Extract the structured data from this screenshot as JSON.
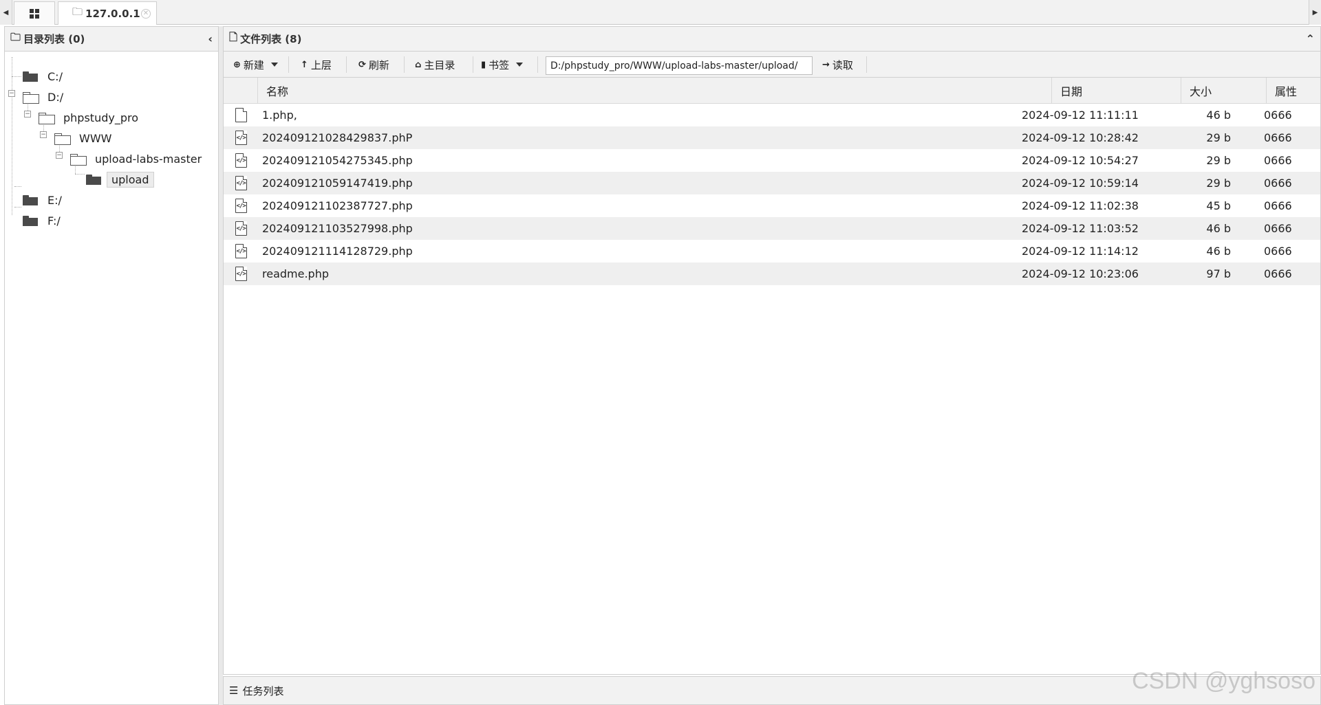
{
  "tabs": {
    "home_icon": "grid-icon",
    "active_label": "127.0.0.1"
  },
  "left": {
    "title": "目录列表 (0)",
    "tree": [
      {
        "label": "C:/"
      },
      {
        "label": "D:/"
      },
      {
        "label": "phpstudy_pro"
      },
      {
        "label": "WWW"
      },
      {
        "label": "upload-labs-master"
      },
      {
        "label": "upload"
      },
      {
        "label": "E:/"
      },
      {
        "label": "F:/"
      }
    ]
  },
  "right": {
    "title": "文件列表 (8)",
    "toolbar": {
      "new": "新建",
      "up": "上层",
      "refresh": "刷新",
      "home": "主目录",
      "bookmark": "书签",
      "path": "D:/phpstudy_pro/WWW/upload-labs-master/upload/",
      "read": "读取"
    },
    "columns": {
      "name": "名称",
      "date": "日期",
      "size": "大小",
      "attr": "属性"
    },
    "files": [
      {
        "name": "1.php,",
        "date": "2024-09-12 11:11:11",
        "size": "46 b",
        "attr": "0666",
        "icon": "file-icon"
      },
      {
        "name": "202409121028429837.phP",
        "date": "2024-09-12 10:28:42",
        "size": "29 b",
        "attr": "0666",
        "icon": "code-file-icon"
      },
      {
        "name": "202409121054275345.php",
        "date": "2024-09-12 10:54:27",
        "size": "29 b",
        "attr": "0666",
        "icon": "code-file-icon"
      },
      {
        "name": "202409121059147419.php",
        "date": "2024-09-12 10:59:14",
        "size": "29 b",
        "attr": "0666",
        "icon": "code-file-icon"
      },
      {
        "name": "202409121102387727.php",
        "date": "2024-09-12 11:02:38",
        "size": "45 b",
        "attr": "0666",
        "icon": "code-file-icon"
      },
      {
        "name": "202409121103527998.php",
        "date": "2024-09-12 11:03:52",
        "size": "46 b",
        "attr": "0666",
        "icon": "code-file-icon"
      },
      {
        "name": "202409121114128729.php",
        "date": "2024-09-12 11:14:12",
        "size": "46 b",
        "attr": "0666",
        "icon": "code-file-icon"
      },
      {
        "name": "readme.php",
        "date": "2024-09-12 10:23:06",
        "size": "97 b",
        "attr": "0666",
        "icon": "code-file-icon"
      }
    ]
  },
  "bottom": {
    "label": "任务列表"
  },
  "watermark": "CSDN @yghsoso"
}
